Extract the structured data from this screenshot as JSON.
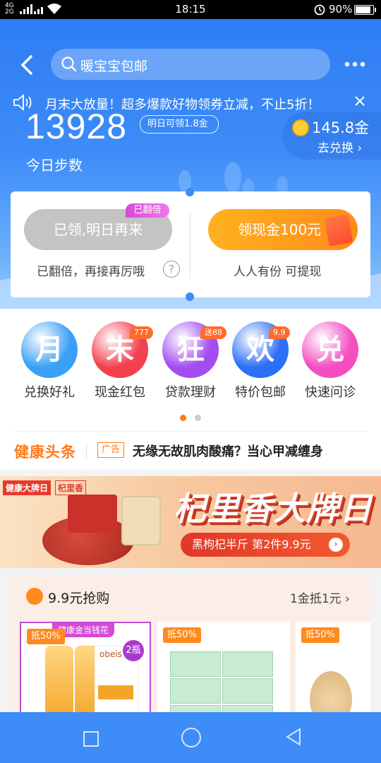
{
  "status_bar": {
    "time": "18:15",
    "battery": "90%",
    "signal_top": "4G",
    "signal_bottom": "2G"
  },
  "header": {
    "search_text": "暖宝宝包邮",
    "notice": "月末大放量！超多爆款好物领券立减，不止5折！",
    "steps": "13928",
    "steps_label": "今日步数",
    "tomorrow_tip": "明日可领1.8金",
    "gold_value": "145.8金",
    "exchange_link": "去兑换 ›"
  },
  "reward_card": {
    "left_button": "已领,明日再来",
    "left_badge": "已翻倍",
    "left_sub": "已翻倍，再接再厉哦",
    "right_button": "领现金100元",
    "right_sub": "人人有份 可提现"
  },
  "quick_icons": [
    {
      "glyph": "月",
      "label": "兑换好礼",
      "badge": "",
      "color": "#3aa0f7"
    },
    {
      "glyph": "末",
      "label": "现金红包",
      "badge": "777",
      "color": "#f2404f"
    },
    {
      "glyph": "狂",
      "label": "贷款理财",
      "badge": "送88",
      "color": "#a24df0"
    },
    {
      "glyph": "欢",
      "label": "特价包邮",
      "badge": "9.9",
      "color": "#2d6ff5"
    },
    {
      "glyph": "兑",
      "label": "快速问诊",
      "badge": "",
      "color": "#f34fc0"
    }
  ],
  "headlines": {
    "title": "健康头条",
    "ad_tag": "广告",
    "text": "无缘无故肌肉酸痛？当心甲减缠身"
  },
  "banner": {
    "brand_left": "健康大牌日",
    "brand_right": "杞里香",
    "headline": "杞里香大牌日",
    "cta": "黑枸杞半斤 第2件9.9元"
  },
  "deals": {
    "title": "9.9元抢购",
    "more": "1金抵1元 ›",
    "products": [
      {
        "tag": "抵50%",
        "ribbon": "健康金当钱花",
        "brand": "obeis",
        "count": "2瓶"
      },
      {
        "tag": "抵50%"
      },
      {
        "tag": "抵50%"
      }
    ]
  }
}
